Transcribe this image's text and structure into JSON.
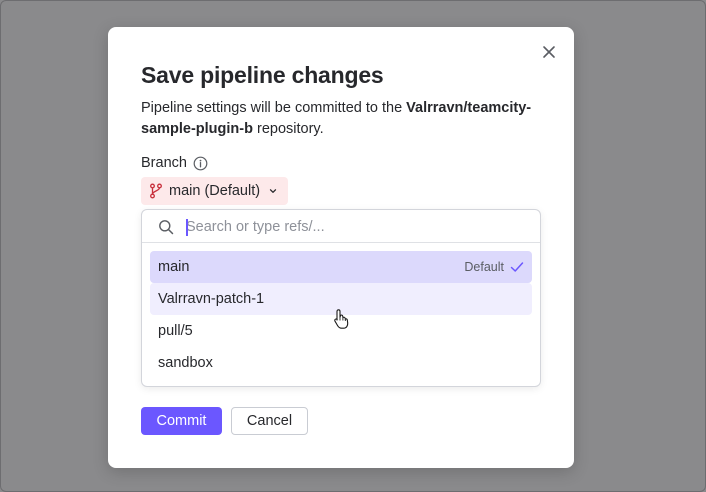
{
  "dialog": {
    "title": "Save pipeline changes",
    "description_prefix": "Pipeline settings will be committed to the ",
    "repository": "Valrravn/teamcity-sample-plugin-b",
    "description_suffix": " repository.",
    "branch_label": "Branch",
    "close_icon": "close-icon",
    "info_icon": "info-icon"
  },
  "branch_selector": {
    "current": "main (Default)",
    "icon": "git-branch-icon",
    "accent": "#fde9ea"
  },
  "dropdown": {
    "search_placeholder": "Search or type refs/...",
    "search_value": "",
    "options": [
      {
        "label": "main",
        "tag": "Default",
        "selected": true
      },
      {
        "label": "Valrravn-patch-1",
        "tag": "",
        "selected": false
      },
      {
        "label": "pull/5",
        "tag": "",
        "selected": false
      },
      {
        "label": "sandbox",
        "tag": "",
        "selected": false
      }
    ]
  },
  "actions": {
    "commit_label": "Commit",
    "cancel_label": "Cancel",
    "primary_color": "#6b57ff"
  }
}
